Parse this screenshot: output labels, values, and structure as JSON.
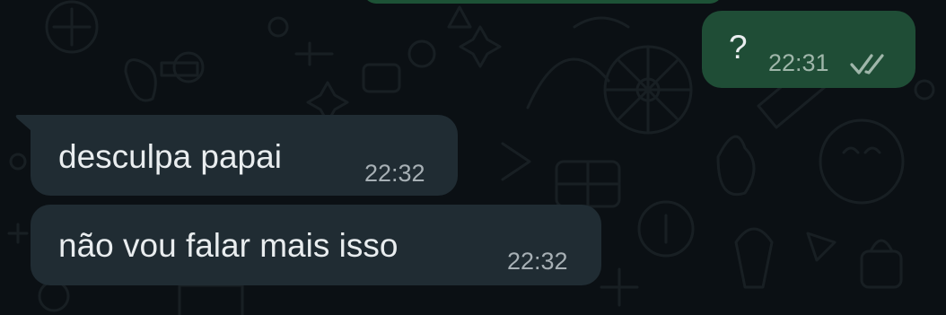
{
  "messages": [
    {
      "direction": "outgoing",
      "text": "?",
      "time": "22:31",
      "status": "delivered-double-tick-icon"
    },
    {
      "direction": "incoming",
      "text": "desculpa papai",
      "time": "22:32"
    },
    {
      "direction": "incoming",
      "text": "não vou falar mais isso",
      "time": "22:32"
    }
  ],
  "colors": {
    "background": "#0b1014",
    "outgoing_bubble": "#1f4d36",
    "incoming_bubble": "#202c33",
    "text": "#e9edef",
    "time": "#a7b0b5"
  }
}
